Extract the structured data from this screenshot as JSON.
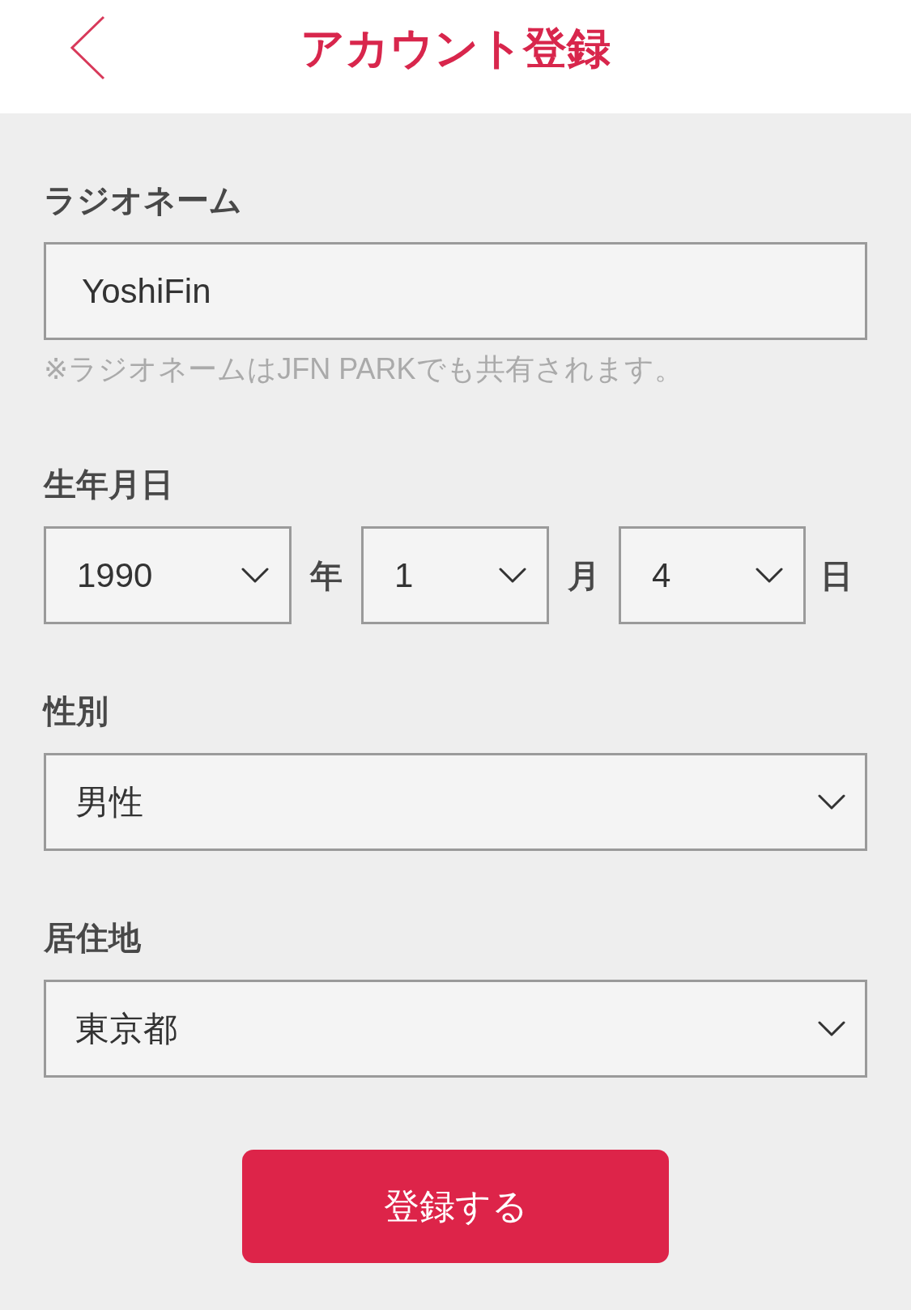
{
  "header": {
    "title": "アカウント登録"
  },
  "fields": [
    {
      "kind": "text",
      "label": "ラジオネーム",
      "value": "YoshiFin",
      "note": "※ラジオネームはJFN PARKでも共有されます。"
    },
    {
      "kind": "date",
      "label": "生年月日",
      "parts": [
        {
          "value": "1990",
          "unit": "年"
        },
        {
          "value": "1",
          "unit": "月"
        },
        {
          "value": "4",
          "unit": "日"
        }
      ]
    },
    {
      "kind": "select",
      "label": "性別",
      "value": "男性"
    },
    {
      "kind": "select",
      "label": "居住地",
      "value": "東京都"
    }
  ],
  "submit_button": {
    "label": "登録する"
  }
}
